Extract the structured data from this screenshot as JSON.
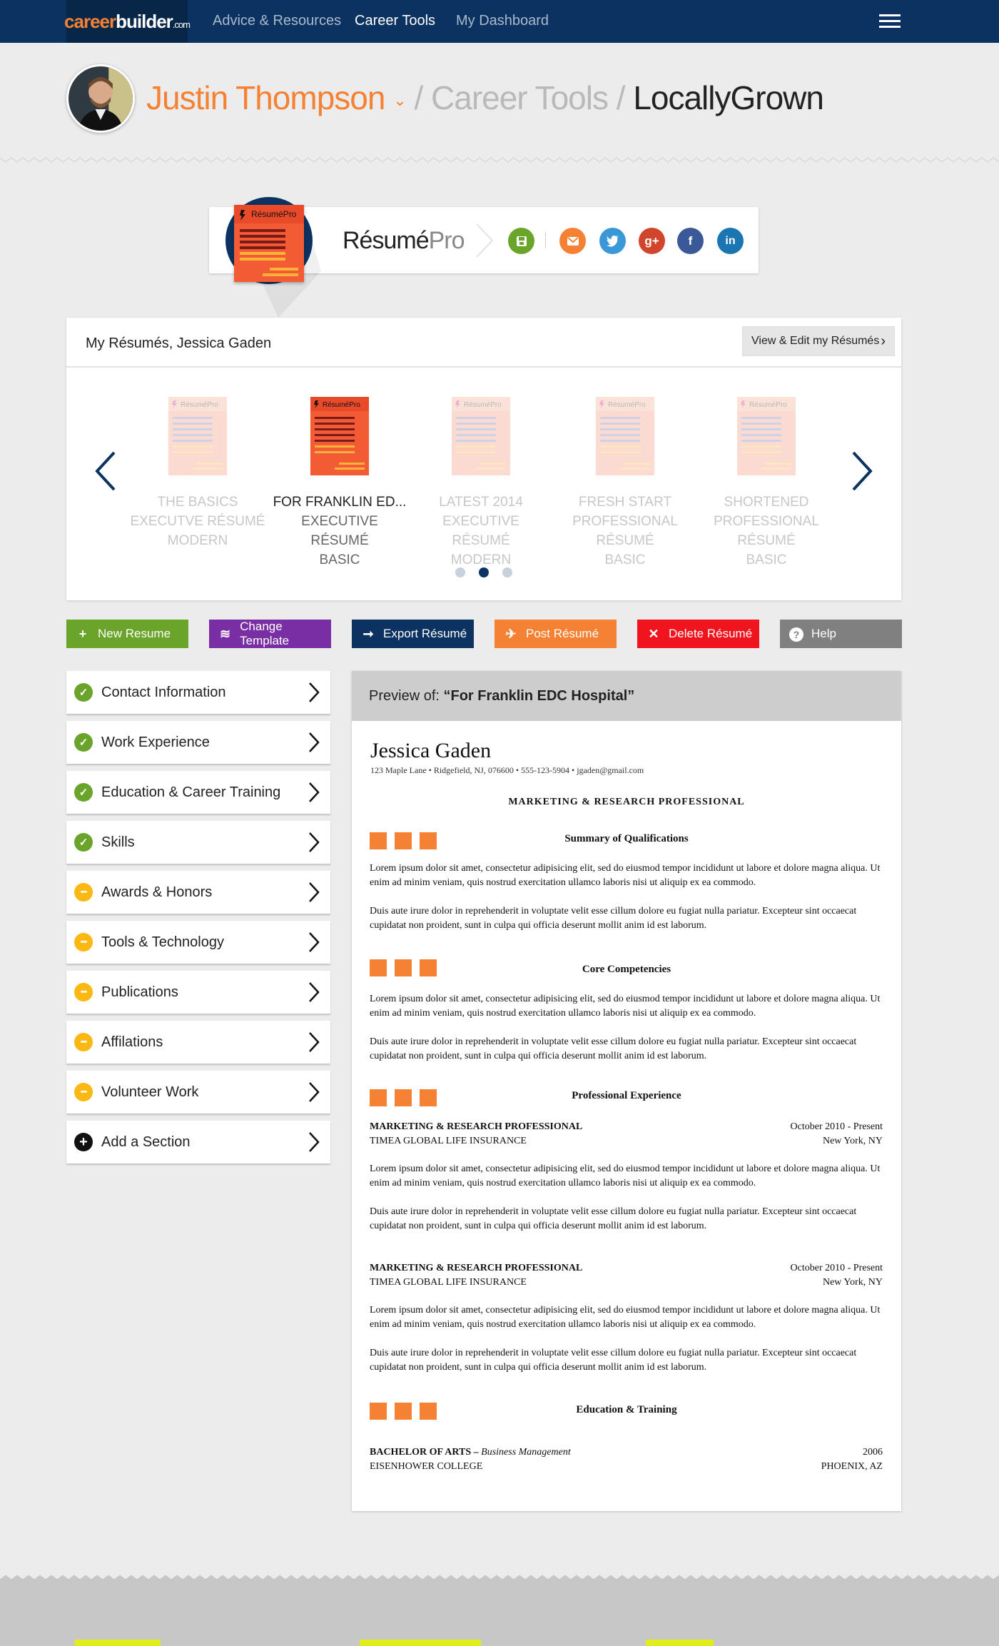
{
  "nav": {
    "logo": {
      "part1": "career",
      "part2": "builder",
      "part3": ".com"
    },
    "links": [
      "Advice & Resources",
      "Career Tools",
      "My Dashboard"
    ],
    "active": "Career Tools"
  },
  "breadcrumb": {
    "user": "Justin Thompson",
    "sep": "/",
    "section": "Career Tools",
    "current": "LocallyGrown"
  },
  "resumepro": {
    "badge_label": "RésuméPro",
    "title_main": "Résumé",
    "title_sub": "Pro",
    "share_icons": [
      "save-icon",
      "email-icon",
      "twitter-icon",
      "google-plus-icon",
      "facebook-icon",
      "linkedin-icon"
    ],
    "colors": {
      "save": "#6aa42b",
      "email": "#f58234",
      "twitter": "#3a98d8",
      "googleplus": "#d0452b",
      "facebook": "#3b5998",
      "linkedin": "#1b75b2"
    }
  },
  "my_resumes": {
    "title": "My Résumés, Jessica Gaden",
    "view_edit": "View & Edit my Résumés",
    "items": [
      {
        "name": "THE BASICS",
        "type": "EXECUTVE RÉSUMÉ",
        "style": "MODERN",
        "selected": false
      },
      {
        "name": "FOR FRANKLIN ED...",
        "type": "EXECUTIVE RÉSUMÉ",
        "style": "BASIC",
        "selected": true
      },
      {
        "name": "LATEST 2014",
        "type": "EXECUTIVE RÉSUMÉ",
        "style": "MODERN",
        "selected": false
      },
      {
        "name": "FRESH START",
        "type": "PROFESSIONAL RÉSUMÉ",
        "style": "BASIC",
        "selected": false
      },
      {
        "name": "SHORTENED",
        "type": "PROFESSIONAL RÉSUMÉ",
        "style": "BASIC",
        "selected": false
      }
    ],
    "page_count": 3,
    "current_page": 2
  },
  "actions": [
    {
      "label": "New Resume",
      "icon": "plus-icon",
      "color": "#6aa42b"
    },
    {
      "label": "Change Template",
      "icon": "waves-icon",
      "color": "#7a2ea3"
    },
    {
      "label": "Export Résumé",
      "icon": "arrow-right-icon",
      "color": "#0b3260"
    },
    {
      "label": "Post Résumé",
      "icon": "plane-icon",
      "color": "#f58234"
    },
    {
      "label": "Delete Résumé",
      "icon": "close-icon",
      "color": "#f0141e"
    },
    {
      "label": "Help",
      "icon": "help-icon",
      "color": "#808080"
    }
  ],
  "sections": [
    {
      "label": "Contact Information",
      "status": "done"
    },
    {
      "label": "Work Experience",
      "status": "done"
    },
    {
      "label": "Education & Career Training",
      "status": "done"
    },
    {
      "label": "Skills",
      "status": "done"
    },
    {
      "label": "Awards & Honors",
      "status": "pending"
    },
    {
      "label": "Tools & Technology",
      "status": "pending"
    },
    {
      "label": "Publications",
      "status": "pending"
    },
    {
      "label": "Affilations",
      "status": "pending"
    },
    {
      "label": "Volunteer Work",
      "status": "pending"
    },
    {
      "label": "Add a Section",
      "status": "add"
    }
  ],
  "preview": {
    "prefix": "Preview of: ",
    "title": "“For Franklin EDC Hospital”",
    "name": "Jessica Gaden",
    "contact": "123 Maple Lane  •  Ridgefield, NJ, 076600  •  555-123-5904  •  jgaden@gmail.com",
    "headline": "MARKETING & RESEARCH PROFESSIONAL",
    "lorem1": "Lorem ipsum dolor sit amet, consectetur adipisicing elit, sed do eiusmod tempor incididunt ut labore et dolore magna aliqua. Ut enim ad minim veniam, quis nostrud exercitation ullamco laboris nisi ut aliquip ex ea commodo.",
    "lorem2": "Duis aute irure dolor in reprehenderit in voluptate velit esse cillum dolore eu fugiat nulla pariatur. Excepteur sint occaecat cupidatat non proident, sunt in culpa qui officia deserunt mollit anim id est laborum.",
    "sections": {
      "qualifications": "Summary of Qualifications",
      "competencies": "Core Competencies",
      "experience": "Professional Experience",
      "education": "Education & Training"
    },
    "jobs": [
      {
        "title": "MARKETING & RESEARCH PROFESSIONAL",
        "company": "TIMEA GLOBAL LIFE INSURANCE",
        "dates": "October 2010 - Present",
        "location": "New York, NY"
      },
      {
        "title": "MARKETING & RESEARCH PROFESSIONAL",
        "company": "TIMEA GLOBAL LIFE INSURANCE",
        "dates": "October 2010 - Present",
        "location": "New York, NY"
      }
    ],
    "edu": {
      "degree": "BACHELOR OF ARTS – ",
      "field": "Business Management",
      "school": "EISENHOWER COLLEGE",
      "year": "2006",
      "location": "PHOENIX, AZ"
    }
  }
}
